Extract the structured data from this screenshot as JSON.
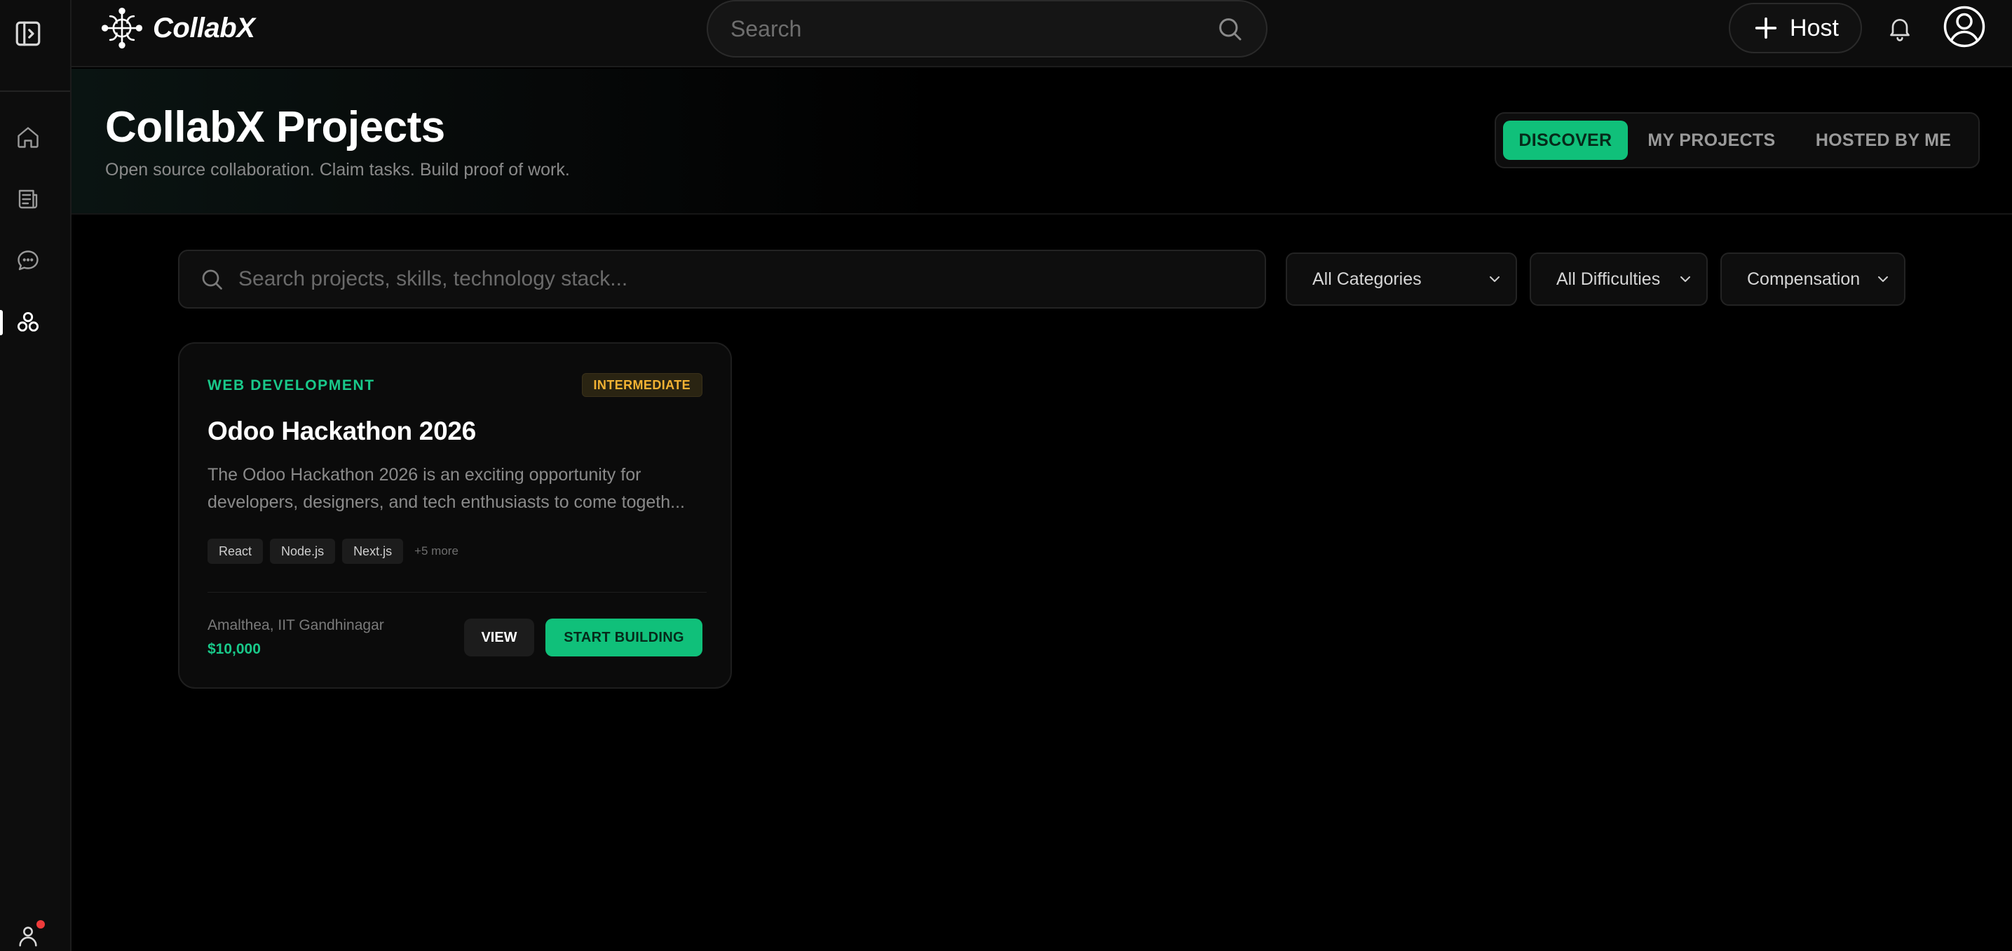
{
  "brand": {
    "name": "CollabX"
  },
  "topbar": {
    "search_placeholder": "Search",
    "host_label": "Host"
  },
  "sidebar": {
    "items": [
      {
        "icon": "home-icon"
      },
      {
        "icon": "newspaper-icon"
      },
      {
        "icon": "chat-icon"
      },
      {
        "icon": "projects-icon",
        "active": true
      }
    ],
    "notification_dot_color": "#ef3b3b"
  },
  "header": {
    "title": "CollabX Projects",
    "subtitle": "Open source collaboration. Claim tasks. Build proof of work.",
    "tabs": [
      {
        "label": "DISCOVER",
        "active": true
      },
      {
        "label": "MY PROJECTS",
        "active": false
      },
      {
        "label": "HOSTED BY ME",
        "active": false
      }
    ]
  },
  "filters": {
    "search_placeholder": "Search projects, skills, technology stack...",
    "category": "All Categories",
    "difficulty": "All Difficulties",
    "compensation": "Compensation"
  },
  "projects": [
    {
      "category": "WEB DEVELOPMENT",
      "difficulty": "INTERMEDIATE",
      "title": "Odoo Hackathon 2026",
      "description_line1": "The Odoo Hackathon 2026 is an exciting opportunity for",
      "description_line2": "developers, designers, and tech enthusiasts to come togeth...",
      "tags": [
        "React",
        "Node.js",
        "Next.js"
      ],
      "more_tags": "+5 more",
      "organizer": "Amalthea, IIT Gandhinagar",
      "reward": "$10,000",
      "view_label": "VIEW",
      "start_label": "START BUILDING"
    }
  ],
  "colors": {
    "accent": "#10c07a",
    "accent_text": "#19c98a",
    "difficulty": "#f2b233",
    "background": "#000000"
  }
}
